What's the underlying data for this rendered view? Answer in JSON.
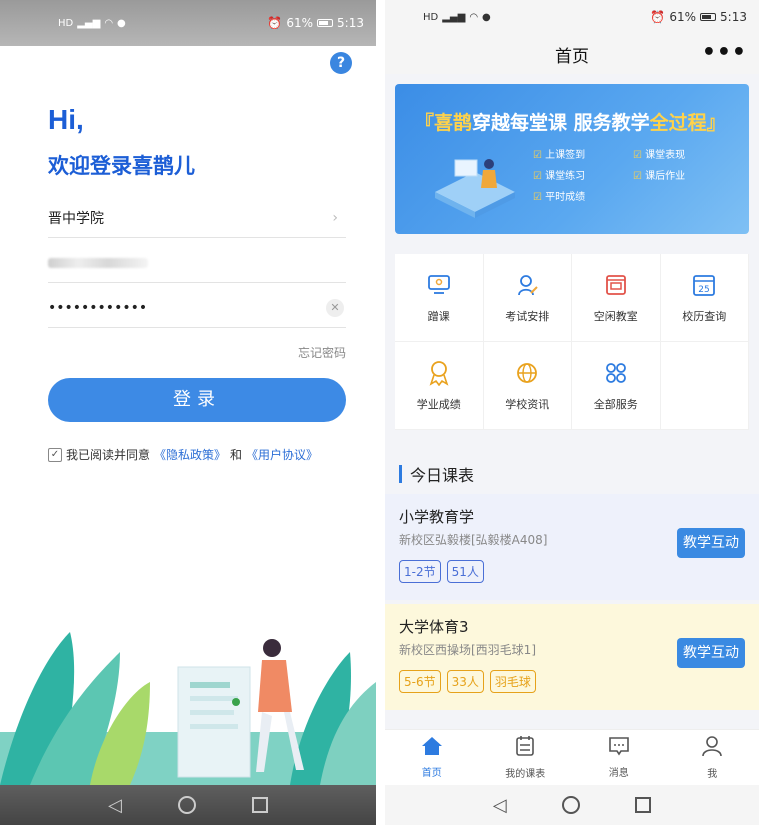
{
  "status_left": {
    "battery": "61%",
    "time": "5:13"
  },
  "status_right": {
    "battery": "61%",
    "time": "5:13"
  },
  "login": {
    "help": "?",
    "greeting": "Hi,",
    "welcome": "欢迎登录喜鹊儿",
    "school": "晋中学院",
    "password_mask": "••••••••••••",
    "forgot": "忘记密码",
    "login_button": "登录",
    "agree_prefix": "我已阅读并同意",
    "privacy_link": "《隐私政策》",
    "and": "和",
    "terms_link": "《用户协议》"
  },
  "home": {
    "title": "首页",
    "more": "•••",
    "banner": {
      "bracket_open": "『",
      "brand": "喜鹊",
      "slogan_mid": "穿越每堂课 服务教学",
      "slogan_hl": "全过程",
      "bracket_close": "』",
      "features": [
        "上课签到",
        "课堂表现",
        "课堂练习",
        "课后作业",
        "平时成绩"
      ]
    },
    "services": [
      {
        "label": "蹭课",
        "icon": "monitor-icon"
      },
      {
        "label": "考试安排",
        "icon": "exam-icon"
      },
      {
        "label": "空闲教室",
        "icon": "classroom-icon"
      },
      {
        "label": "校历查询",
        "icon": "calendar-icon"
      },
      {
        "label": "学业成绩",
        "icon": "award-icon"
      },
      {
        "label": "学校资讯",
        "icon": "globe-icon"
      },
      {
        "label": "全部服务",
        "icon": "grid-icon"
      }
    ],
    "calendar_day": "25",
    "today_title": "今日课表",
    "courses": [
      {
        "name": "小学教育学",
        "location": "新校区弘毅楼[弘毅楼A408]",
        "tags": [
          "1-2节",
          "51人"
        ],
        "action": "教学互动"
      },
      {
        "name": "大学体育3",
        "location": "新校区西操场[西羽毛球1]",
        "tags": [
          "5-6节",
          "33人",
          "羽毛球"
        ],
        "action": "教学互动"
      }
    ],
    "tabs": [
      {
        "label": "首页",
        "icon": "home-icon"
      },
      {
        "label": "我的课表",
        "icon": "schedule-icon"
      },
      {
        "label": "消息",
        "icon": "message-icon"
      },
      {
        "label": "我",
        "icon": "person-icon"
      }
    ],
    "colors": {
      "accent": "#2d7be0",
      "course1_bg": "#eef1fb",
      "course2_bg": "#fdf8dc",
      "tag1": "#4a6fd6",
      "tag2": "#e6a21a"
    }
  }
}
